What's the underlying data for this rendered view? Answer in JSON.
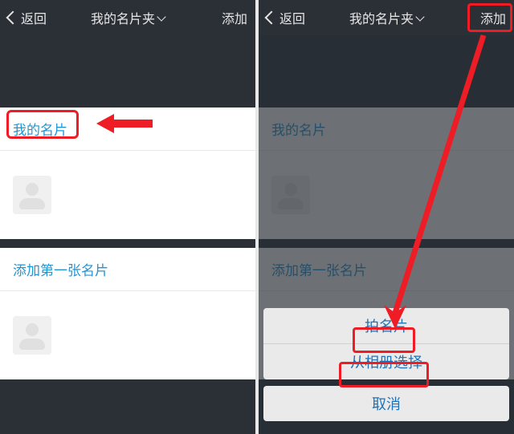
{
  "nav": {
    "back": "返回",
    "title": "我的名片夹",
    "add": "添加"
  },
  "left_screen": {
    "my_card_header": "我的名片",
    "add_first_card": "添加第一张名片"
  },
  "right_screen": {
    "my_card_header": "我的名片",
    "add_first_card": "添加第一张名片",
    "sheet": {
      "shoot": "拍名片",
      "album": "从相册选择",
      "cancel": "取消"
    }
  }
}
